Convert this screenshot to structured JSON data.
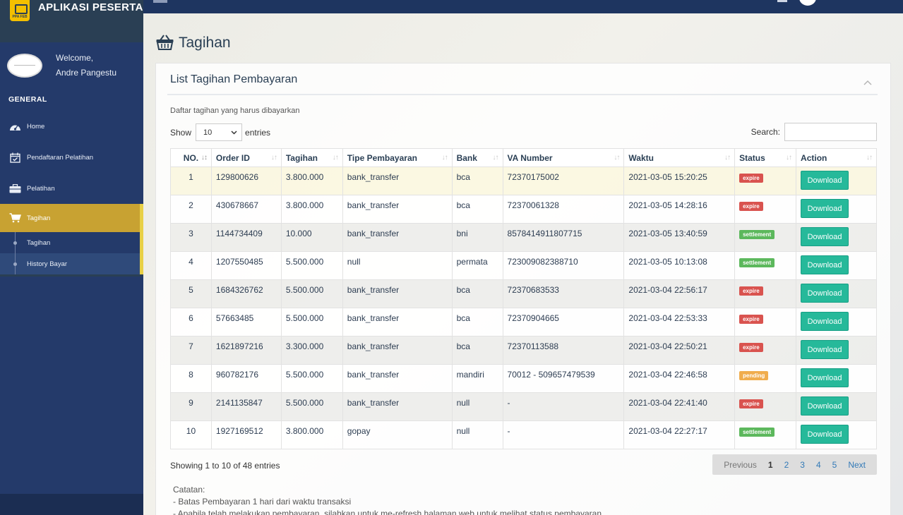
{
  "app": {
    "title": "APLIKASI PESERTA",
    "logo_text": "PPA FEB"
  },
  "profile": {
    "welcome": "Welcome,",
    "name": "Andre Pangestu"
  },
  "sidebar": {
    "section": "GENERAL",
    "items": [
      {
        "label": "Home",
        "icon": "dashboard-icon"
      },
      {
        "label": "Pendaftaran Pelatihan",
        "icon": "calendar-check-icon"
      },
      {
        "label": "Pelatihan",
        "icon": "briefcase-icon"
      },
      {
        "label": "Tagihan",
        "icon": "cart-icon",
        "active": true
      }
    ],
    "submenu": [
      {
        "label": "Tagihan"
      },
      {
        "label": "History Bayar"
      }
    ]
  },
  "page": {
    "title": "Tagihan",
    "icon": "basket-icon"
  },
  "panel": {
    "title": "List Tagihan Pembayaran",
    "description": "Daftar tagihan yang harus dibayarkan",
    "show_label": "Show",
    "entries_label": "entries",
    "page_size": "10",
    "search_label": "Search:",
    "search_value": ""
  },
  "table": {
    "columns": [
      "NO.",
      "Order ID",
      "Tagihan",
      "Tipe Pembayaran",
      "Bank",
      "VA Number",
      "Waktu",
      "Status",
      "Action"
    ],
    "rows": [
      {
        "no": "1",
        "order_id": "129800626",
        "tagihan": "3.800.000",
        "tipe": "bank_transfer",
        "bank": "bca",
        "va": "72370175002",
        "waktu": "2021-03-05 15:20:25",
        "status": "expire",
        "action": "Download"
      },
      {
        "no": "2",
        "order_id": "430678667",
        "tagihan": "3.800.000",
        "tipe": "bank_transfer",
        "bank": "bca",
        "va": "72370061328",
        "waktu": "2021-03-05 14:28:16",
        "status": "expire",
        "action": "Download"
      },
      {
        "no": "3",
        "order_id": "1144734409",
        "tagihan": "10.000",
        "tipe": "bank_transfer",
        "bank": "bni",
        "va": "8578414911807715",
        "waktu": "2021-03-05 13:40:59",
        "status": "settlement",
        "action": "Download"
      },
      {
        "no": "4",
        "order_id": "1207550485",
        "tagihan": "5.500.000",
        "tipe": "null",
        "bank": "permata",
        "va": "723009082388710",
        "waktu": "2021-03-05 10:13:08",
        "status": "settlement",
        "action": "Download"
      },
      {
        "no": "5",
        "order_id": "1684326762",
        "tagihan": "5.500.000",
        "tipe": "bank_transfer",
        "bank": "bca",
        "va": "72370683533",
        "waktu": "2021-03-04 22:56:17",
        "status": "expire",
        "action": "Download"
      },
      {
        "no": "6",
        "order_id": "57663485",
        "tagihan": "5.500.000",
        "tipe": "bank_transfer",
        "bank": "bca",
        "va": "72370904665",
        "waktu": "2021-03-04 22:53:33",
        "status": "expire",
        "action": "Download"
      },
      {
        "no": "7",
        "order_id": "1621897216",
        "tagihan": "3.300.000",
        "tipe": "bank_transfer",
        "bank": "bca",
        "va": "72370113588",
        "waktu": "2021-03-04 22:50:21",
        "status": "expire",
        "action": "Download"
      },
      {
        "no": "8",
        "order_id": "960782176",
        "tagihan": "5.500.000",
        "tipe": "bank_transfer",
        "bank": "mandiri",
        "va": "70012 - 509657479539",
        "waktu": "2021-03-04 22:46:58",
        "status": "pending",
        "action": "Download"
      },
      {
        "no": "9",
        "order_id": "2141135847",
        "tagihan": "5.500.000",
        "tipe": "bank_transfer",
        "bank": "null",
        "va": "-",
        "waktu": "2021-03-04 22:41:40",
        "status": "expire",
        "action": "Download"
      },
      {
        "no": "10",
        "order_id": "1927169512",
        "tagihan": "3.800.000",
        "tipe": "gopay",
        "bank": "null",
        "va": "-",
        "waktu": "2021-03-04 22:27:17",
        "status": "settlement",
        "action": "Download"
      }
    ]
  },
  "footer": {
    "info": "Showing 1 to 10 of 48 entries",
    "pagination": {
      "prev": "Previous",
      "pages": [
        "1",
        "2",
        "3",
        "4",
        "5"
      ],
      "current": "1",
      "next": "Next"
    }
  },
  "notes": {
    "title": "Catatan:",
    "lines": [
      "- Batas Pembayaran 1 hari dari waktu transaksi",
      "- Apabila telah melakukan pembayaran, silahkan untuk me-refresh halaman web untuk melihat status pembayaran"
    ]
  },
  "colors": {
    "sidebar": "#2a3f54",
    "active_menu": "#c8a232",
    "download_button": "#26b99a",
    "expire": "#d9534f",
    "settlement": "#5cb85c",
    "pending": "#f0ad4e"
  }
}
